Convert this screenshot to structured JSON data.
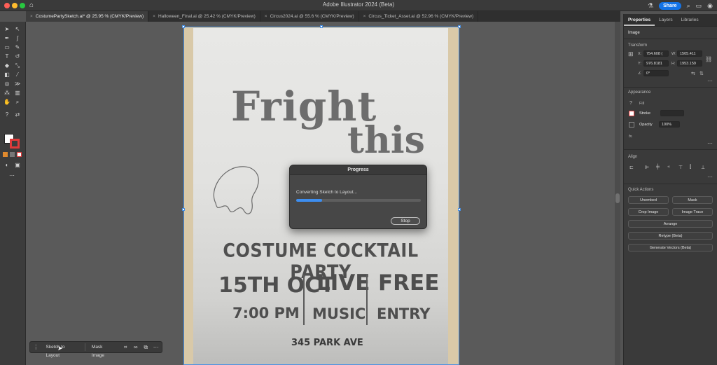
{
  "window": {
    "title": "Adobe Illustrator 2024 (Beta)",
    "share_label": "Share"
  },
  "tabs": [
    {
      "label": "CostumePartySketch.ai* @ 25.95 % (CMYK/Preview)",
      "active": true
    },
    {
      "label": "Halloween_Final.ai @ 25.42 % (CMYK/Preview)",
      "active": false
    },
    {
      "label": "Circus2024.ai @ 55.6 % (CMYK/Preview)",
      "active": false
    },
    {
      "label": "Circus_Ticket_Asset.ai @ 52.96 % (CMYK/Preview)",
      "active": false
    }
  ],
  "sketch": {
    "line1": "Fright",
    "line2": "this",
    "party": "COSTUME COCKTAIL PARTY",
    "date": "15TH OCT",
    "time": "7:00 PM",
    "live": "LIVE",
    "music": "MUSIC",
    "free": "FREE",
    "entry": "ENTRY",
    "address": "345 PARK AVE"
  },
  "progress_dialog": {
    "title": "Progress",
    "message": "Converting Sketch to Layout...",
    "progress": 0.21,
    "stop_label": "Stop"
  },
  "context_bar": {
    "sketch_to_layout": "Sketch to Layout",
    "mask_image": "Mask Image"
  },
  "panel": {
    "tabs": [
      "Properties",
      "Layers",
      "Libraries"
    ],
    "object_type": "Image",
    "transform": {
      "title": "Transform",
      "x_label": "X:",
      "x": "754.608 (",
      "y_label": "Y:",
      "y": "976.8181",
      "w_label": "W:",
      "w": "1505.411",
      "h_label": "H:",
      "h": "1953.159",
      "angle": "0°"
    },
    "appearance": {
      "title": "Appearance",
      "fill_label": "Fill",
      "stroke_label": "Stroke",
      "opacity_label": "Opacity",
      "opacity": "100%",
      "fx": "fx."
    },
    "align": {
      "title": "Align"
    },
    "quick_actions": {
      "title": "Quick Actions",
      "unembed": "Unembed",
      "mask": "Mask",
      "crop_image": "Crop Image",
      "image_trace": "Image Trace",
      "arrange": "Arrange",
      "retype": "Retype (Beta)",
      "generate_vectors": "Generate Vectors (Beta)"
    }
  },
  "colors": {
    "accent": "#1473e6",
    "progress": "#3d8ef0",
    "stroke_swatch": "#e03a3a"
  },
  "icons": [
    "home-icon",
    "search-icon",
    "profile-icon",
    "selection-tool-icon",
    "pen-tool-icon",
    "type-tool-icon",
    "zoom-tool-icon",
    "hand-tool-icon",
    "link-icon",
    "more-icon"
  ]
}
